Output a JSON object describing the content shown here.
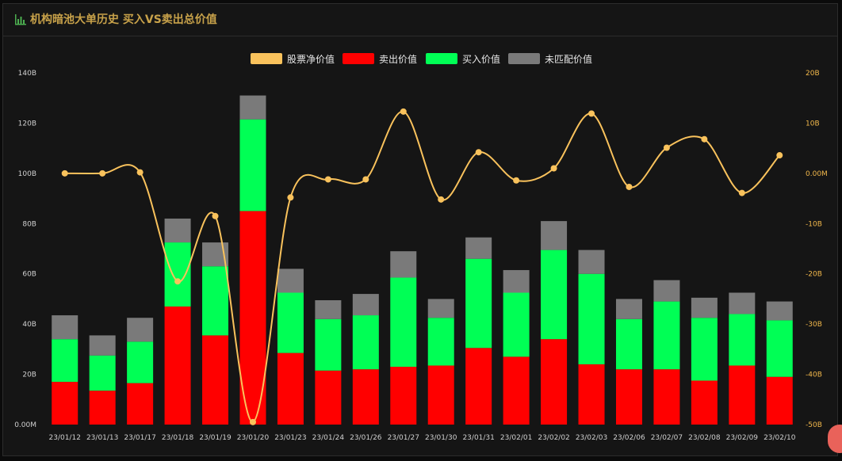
{
  "header": {
    "title": "机构暗池大单历史 买入VS卖出总价值"
  },
  "colors": {
    "net": "#f9c25c",
    "sell": "#ff0000",
    "buy": "#00ff55",
    "unmatched": "#7a7a7a",
    "title": "#c8a24a",
    "axis_left": "#d0d0d0",
    "axis_right": "#f2b84b"
  },
  "legend": [
    "股票净价值",
    "卖出价值",
    "买入价值",
    "未匹配价值"
  ],
  "chart_data": {
    "type": "bar",
    "stacked": true,
    "categories": [
      "23/01/12",
      "23/01/13",
      "23/01/17",
      "23/01/18",
      "23/01/19",
      "23/01/20",
      "23/01/23",
      "23/01/24",
      "23/01/26",
      "23/01/27",
      "23/01/30",
      "23/01/31",
      "23/02/01",
      "23/02/02",
      "23/02/03",
      "23/02/06",
      "23/02/07",
      "23/02/08",
      "23/02/09",
      "23/02/10"
    ],
    "series": [
      {
        "name": "卖出价值",
        "type": "bar",
        "axis": "left",
        "values": [
          17,
          13.5,
          16.5,
          47,
          35.5,
          85,
          28.5,
          21.5,
          22,
          23,
          23.5,
          30.5,
          27,
          34,
          24,
          22,
          22,
          17.5,
          23.5,
          19
        ]
      },
      {
        "name": "买入价值",
        "type": "bar",
        "axis": "left",
        "values": [
          17,
          14,
          16.5,
          25.5,
          27.5,
          36.5,
          24,
          20.5,
          21.5,
          35.5,
          19,
          35.5,
          25.5,
          35.5,
          36,
          20,
          27,
          25,
          20.5,
          22.5
        ]
      },
      {
        "name": "未匹配价值",
        "type": "bar",
        "axis": "left",
        "values": [
          9.5,
          8,
          9.5,
          9.5,
          9.5,
          9.5,
          9.5,
          7.5,
          8.5,
          10.5,
          7.5,
          8.5,
          9,
          11.5,
          9.5,
          8,
          8.5,
          8,
          8.5,
          7.5
        ]
      },
      {
        "name": "股票净价值",
        "type": "line",
        "axis": "right",
        "smooth": true,
        "values": [
          0,
          0,
          0.2,
          -21.5,
          -8.5,
          -49.5,
          -4.8,
          -1.2,
          -1.2,
          12.3,
          -5.2,
          4.2,
          -1.4,
          1,
          11.9,
          -2.7,
          5.1,
          6.8,
          -3.9,
          3.6
        ]
      }
    ],
    "y_left": {
      "min": 0,
      "max": 140,
      "ticks": [
        "0.00M",
        "20B",
        "40B",
        "60B",
        "80B",
        "100B",
        "120B",
        "140B"
      ]
    },
    "y_right": {
      "min": -50,
      "max": 20,
      "ticks": [
        "-50B",
        "-40B",
        "-30B",
        "-20B",
        "-10B",
        "0.00M",
        "10B",
        "20B"
      ]
    },
    "grid": false,
    "legend_position": "top-center"
  }
}
